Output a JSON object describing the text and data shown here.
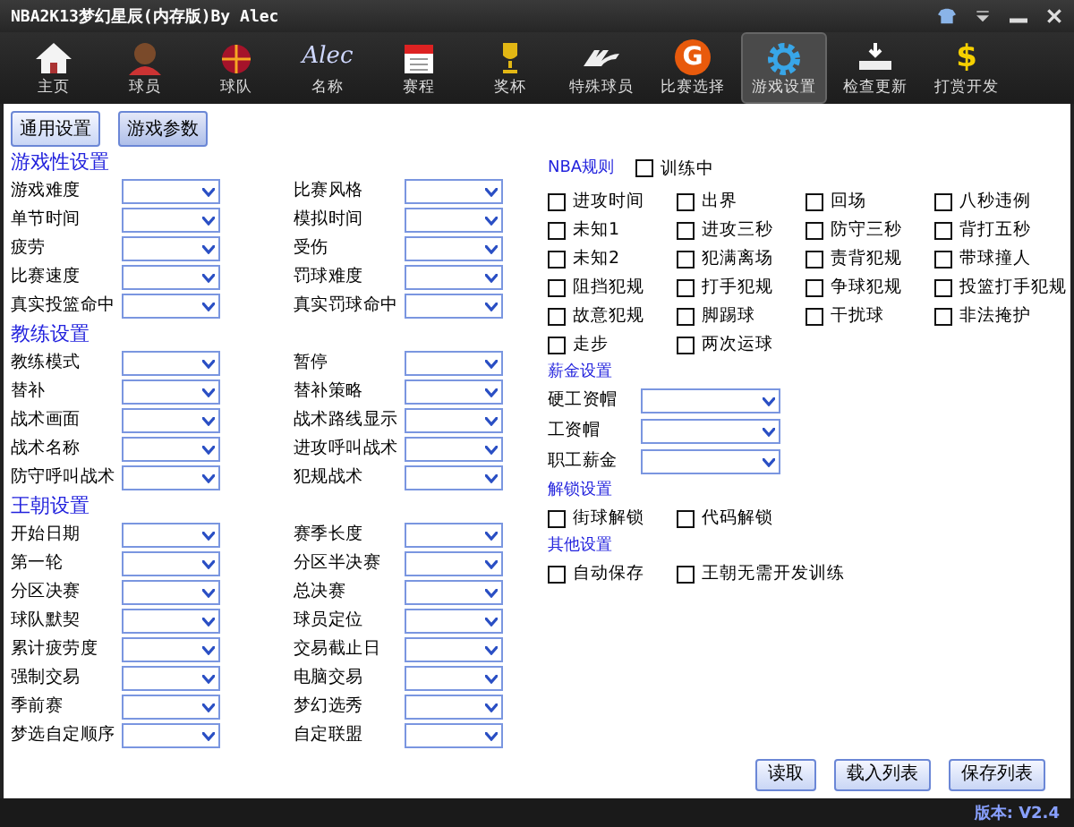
{
  "window": {
    "title": "NBA2K13梦幻星辰(内存版)By Alec"
  },
  "toolbar": [
    {
      "label": "主页",
      "selected": false
    },
    {
      "label": "球员",
      "selected": false
    },
    {
      "label": "球队",
      "selected": false
    },
    {
      "label": "名称",
      "logo_text": "Alec",
      "selected": false
    },
    {
      "label": "赛程",
      "selected": false
    },
    {
      "label": "奖杯",
      "selected": false
    },
    {
      "label": "特殊球员",
      "selected": false
    },
    {
      "label": "比赛选择",
      "logo_text": "G",
      "selected": false
    },
    {
      "label": "游戏设置",
      "selected": true
    },
    {
      "label": "检查更新",
      "selected": false
    },
    {
      "label": "打赏开发",
      "logo_text": "$",
      "selected": false
    }
  ],
  "subtabs": [
    {
      "label": "通用设置",
      "selected": false
    },
    {
      "label": "游戏参数",
      "selected": true
    }
  ],
  "left_sections": [
    {
      "title": "游戏性设置",
      "fields": [
        {
          "label": "游戏难度"
        },
        {
          "label": "比赛风格"
        },
        {
          "label": "单节时间"
        },
        {
          "label": "模拟时间"
        },
        {
          "label": "疲劳"
        },
        {
          "label": "受伤"
        },
        {
          "label": "比赛速度"
        },
        {
          "label": "罚球难度"
        },
        {
          "label": "真实投篮命中"
        },
        {
          "label": "真实罚球命中"
        }
      ]
    },
    {
      "title": "教练设置",
      "fields": [
        {
          "label": "教练模式"
        },
        {
          "label": "暂停"
        },
        {
          "label": "替补"
        },
        {
          "label": "替补策略"
        },
        {
          "label": "战术画面"
        },
        {
          "label": "战术路线显示"
        },
        {
          "label": "战术名称"
        },
        {
          "label": "进攻呼叫战术"
        },
        {
          "label": "防守呼叫战术"
        },
        {
          "label": "犯规战术"
        }
      ]
    },
    {
      "title": "王朝设置",
      "fields": [
        {
          "label": "开始日期"
        },
        {
          "label": "赛季长度"
        },
        {
          "label": "第一轮"
        },
        {
          "label": "分区半决赛"
        },
        {
          "label": "分区决赛"
        },
        {
          "label": "总决赛"
        },
        {
          "label": "球队默契"
        },
        {
          "label": "球员定位"
        },
        {
          "label": "累计疲劳度"
        },
        {
          "label": "交易截止日"
        },
        {
          "label": "强制交易"
        },
        {
          "label": "电脑交易"
        },
        {
          "label": "季前赛"
        },
        {
          "label": "梦幻选秀"
        },
        {
          "label": "梦选自定顺序"
        },
        {
          "label": "自定联盟"
        }
      ]
    }
  ],
  "nba_rules": {
    "title": "NBA规则",
    "training": {
      "label": "训练中",
      "checked": false
    },
    "checkboxes": [
      {
        "label": "进攻时间",
        "checked": false
      },
      {
        "label": "出界",
        "checked": false
      },
      {
        "label": "回场",
        "checked": false
      },
      {
        "label": "八秒违例",
        "checked": false
      },
      {
        "label": "未知1",
        "checked": false
      },
      {
        "label": "进攻三秒",
        "checked": false
      },
      {
        "label": "防守三秒",
        "checked": false
      },
      {
        "label": "背打五秒",
        "checked": false
      },
      {
        "label": "未知2",
        "checked": false
      },
      {
        "label": "犯满离场",
        "checked": false
      },
      {
        "label": "责背犯规",
        "checked": false
      },
      {
        "label": "带球撞人",
        "checked": false
      },
      {
        "label": "阻挡犯规",
        "checked": false
      },
      {
        "label": "打手犯规",
        "checked": false
      },
      {
        "label": "争球犯规",
        "checked": false
      },
      {
        "label": "投篮打手犯规",
        "checked": false
      },
      {
        "label": "故意犯规",
        "checked": false
      },
      {
        "label": "脚踢球",
        "checked": false
      },
      {
        "label": "干扰球",
        "checked": false
      },
      {
        "label": "非法掩护",
        "checked": false
      },
      {
        "label": "走步",
        "checked": false
      },
      {
        "label": "两次运球",
        "checked": false
      }
    ]
  },
  "salary": {
    "title": "薪金设置",
    "fields": [
      {
        "label": "硬工资帽"
      },
      {
        "label": "工资帽"
      },
      {
        "label": "职工薪金"
      }
    ]
  },
  "unlock": {
    "title": "解锁设置",
    "checkboxes": [
      {
        "label": "街球解锁",
        "checked": false
      },
      {
        "label": "代码解锁",
        "checked": false
      }
    ]
  },
  "other": {
    "title": "其他设置",
    "checkboxes": [
      {
        "label": "自动保存",
        "checked": false
      },
      {
        "label": "王朝无需开发训练",
        "checked": false
      }
    ]
  },
  "actions": [
    "读取",
    "载入列表",
    "保存列表"
  ],
  "status_bar": {
    "version": "版本: V2.4"
  }
}
